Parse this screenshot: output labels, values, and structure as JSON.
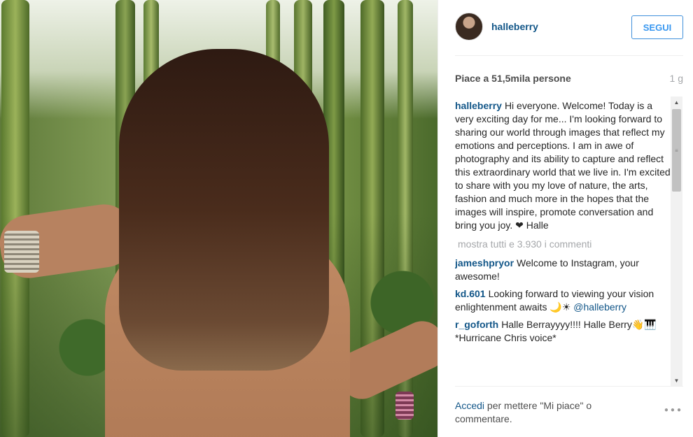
{
  "post": {
    "username": "halleberry",
    "follow_label": "SEGUI",
    "likes": "Piace a 51,5mila persone",
    "time": "1 g",
    "caption": {
      "user": "halleberry",
      "text": "Hi everyone. Welcome! Today is a very exciting day for me... I'm looking forward to sharing our world through images that reflect my emotions and perceptions. I am in awe of photography and its ability to capture and reflect this extraordinary world that we live in. I'm excited to share with you my love of nature, the arts, fashion and much more in the hopes that the images will inspire, promote conversation and bring you joy. ❤ Halle"
    },
    "show_all_comments": "mostra tutti e 3.930 i commenti",
    "comments": [
      {
        "user": "jameshpryor",
        "text": "Welcome to Instagram, your awesome!"
      },
      {
        "user": "kd.601",
        "text": "Looking forward to viewing your vision enlightenment awaits 🌙☀",
        "mention": "@halleberry"
      },
      {
        "user": "r_goforth",
        "text": "Halle Berrayyyy!!!! Halle Berry👋🎹 *Hurricane Chris voice*"
      }
    ],
    "footer": {
      "login_link": "Accedi",
      "login_text": " per mettere \"Mi piace\" o commentare."
    },
    "icons": {
      "more": "more-options-icon",
      "scroll_up": "scroll-up-icon",
      "scroll_down": "scroll-down-icon"
    },
    "colors": {
      "link": "#125688",
      "follow_border": "#4090db",
      "muted": "#a5a7aa"
    }
  }
}
